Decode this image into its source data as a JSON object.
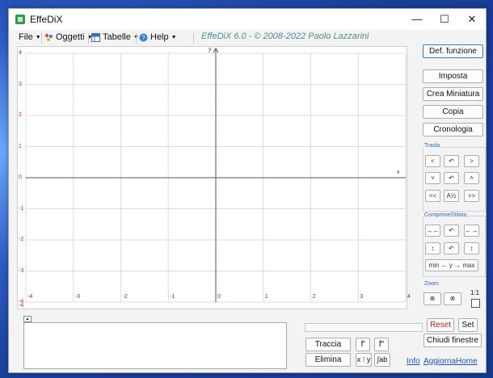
{
  "window": {
    "title": "EffeDiX",
    "controls": {
      "minimize": "—",
      "maximize": "☐",
      "close": "✕"
    }
  },
  "menubar": {
    "file": "File",
    "oggetti": "Oggetti",
    "tabelle": "Tabelle",
    "help": "Help",
    "credit": "EffeDiX 6.0 - © 2008-2022 Paolo Lazzarini"
  },
  "plot": {
    "x_ticks": [
      "-4",
      "-3",
      "-2",
      "-1",
      "0",
      "1",
      "2",
      "3",
      "4"
    ],
    "y_ticks": [
      "4",
      "3",
      "2",
      "1",
      "0",
      "-1",
      "-2",
      "-3",
      "-4"
    ],
    "x_axis_label": "x",
    "y_axis_label": "y",
    "extra_y_label": "-4",
    "accent_y": "#d22222",
    "grid_color": "#dcdcdc",
    "axis_color": "#555555"
  },
  "chart_data": {
    "type": "scatter",
    "x": [],
    "y": [],
    "xlabel": "x",
    "ylabel": "y",
    "xlim": [
      -4,
      4
    ],
    "ylim": [
      -4,
      4
    ],
    "grid": true
  },
  "sidebar": {
    "def_funzione": "Def. funzione",
    "imposta": "Imposta",
    "crea_miniatura": "Crea Miniatura",
    "copia": "Copia",
    "cronologia": "Cronologia",
    "trasla_label": "Trasla",
    "trasla": {
      "left": "<",
      "undo1": "↶",
      "right": ">",
      "down": "˅",
      "undo2": "↶",
      "up": "˄",
      "far_left": "<<",
      "reset": "A½",
      "far_right": ">>"
    },
    "comprime_label": "Comprime/Dilata",
    "comprime": {
      "h_compress": "→←",
      "undo1": "↶",
      "h_expand": "←→",
      "v_compress": "↕",
      "undo2": "↶",
      "v_expand": "↕",
      "minmax": "min ← y → max"
    },
    "zoom_label": "Zoom",
    "zoom": {
      "zoom_out": "⊕",
      "zoom_in": "⊗",
      "ratio": "1:1"
    },
    "reset": "Reset",
    "set": "Set",
    "chiudi_finestre": "Chiudi finestre"
  },
  "bottom": {
    "traccia": "Traccia",
    "elimina": "Elimina",
    "f_prime": "f'",
    "f_second": "f\"",
    "xy": "x ⁝ y",
    "integral": "∫ab",
    "info": "Info",
    "aggiorna": "Aggiorna",
    "home": "Home"
  }
}
